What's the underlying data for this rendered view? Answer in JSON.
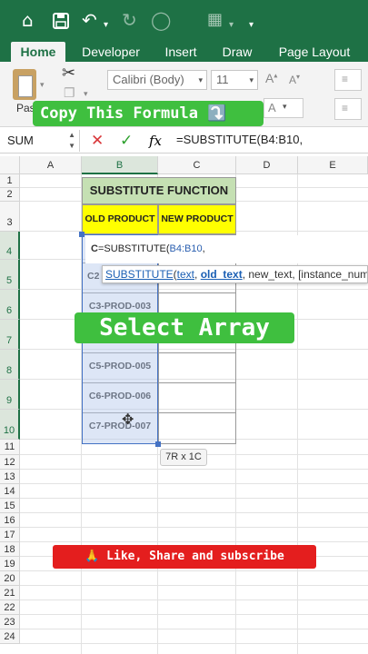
{
  "titlebar": {
    "icons": [
      "home-icon",
      "save-icon",
      "undo-icon",
      "undo-dropdown-icon",
      "redo-icon",
      "circle-icon",
      "customize-icon",
      "more-dropdown-icon"
    ]
  },
  "tabs": [
    {
      "label": "Home",
      "active": true
    },
    {
      "label": "Developer"
    },
    {
      "label": "Insert"
    },
    {
      "label": "Draw"
    },
    {
      "label": "Page Layout"
    }
  ],
  "ribbon": {
    "paste_label": "Pas",
    "font_name": "Calibri (Body)",
    "font_size": "11",
    "increase_font": "A",
    "decrease_font": "A"
  },
  "banner_top": {
    "text": "Copy This Formula",
    "emoji": "⤵️"
  },
  "formula_bar": {
    "name_box": "SUM",
    "cancel": "✕",
    "enter": "✓",
    "fx": "fx",
    "formula": "=SUBSTITUTE(B4:B10,"
  },
  "columns": [
    "A",
    "B",
    "C",
    "D",
    "E"
  ],
  "rows": [
    "1",
    "2",
    "3",
    "4",
    "5",
    "6",
    "7",
    "8",
    "9",
    "10",
    "11",
    "12",
    "13",
    "14",
    "15",
    "16",
    "17",
    "18",
    "19",
    "20",
    "21",
    "22",
    "23",
    "24"
  ],
  "sheet": {
    "title": "SUBSTITUTE FUNCTION",
    "header_old": "OLD PRODUCT",
    "header_new": "NEW PRODUCT",
    "c4_prefix": "C",
    "c4_formula_pre": "=SUBSTITUTE(",
    "c4_formula_ref": "B4:B10",
    "c4_formula_post": ",",
    "b5": "C2",
    "b6": "C3-PROD-003",
    "b8": "C5-PROD-005",
    "b9": "C6-PROD-006",
    "b10": "C7-PROD-007"
  },
  "tooltip": {
    "func": "SUBSTITUTE",
    "paren": "(",
    "arg1": "text",
    "sep1": ", ",
    "arg2": "old_text",
    "rest": ", new_text, [instance_num"
  },
  "banner_mid": {
    "text": "Select Array"
  },
  "dim_tip": "7R x 1C",
  "like_banner": {
    "text": "🙏 Like, Share and subscribe"
  },
  "colors": {
    "excel_green": "#1e7145",
    "title_fill": "#c5e0b3",
    "header_fill": "#ffff00",
    "selection_fill": "#dbe5f1",
    "selection_border": "#4472c4",
    "banner_green": "#3fbf3f",
    "like_red": "#e41e1e"
  }
}
